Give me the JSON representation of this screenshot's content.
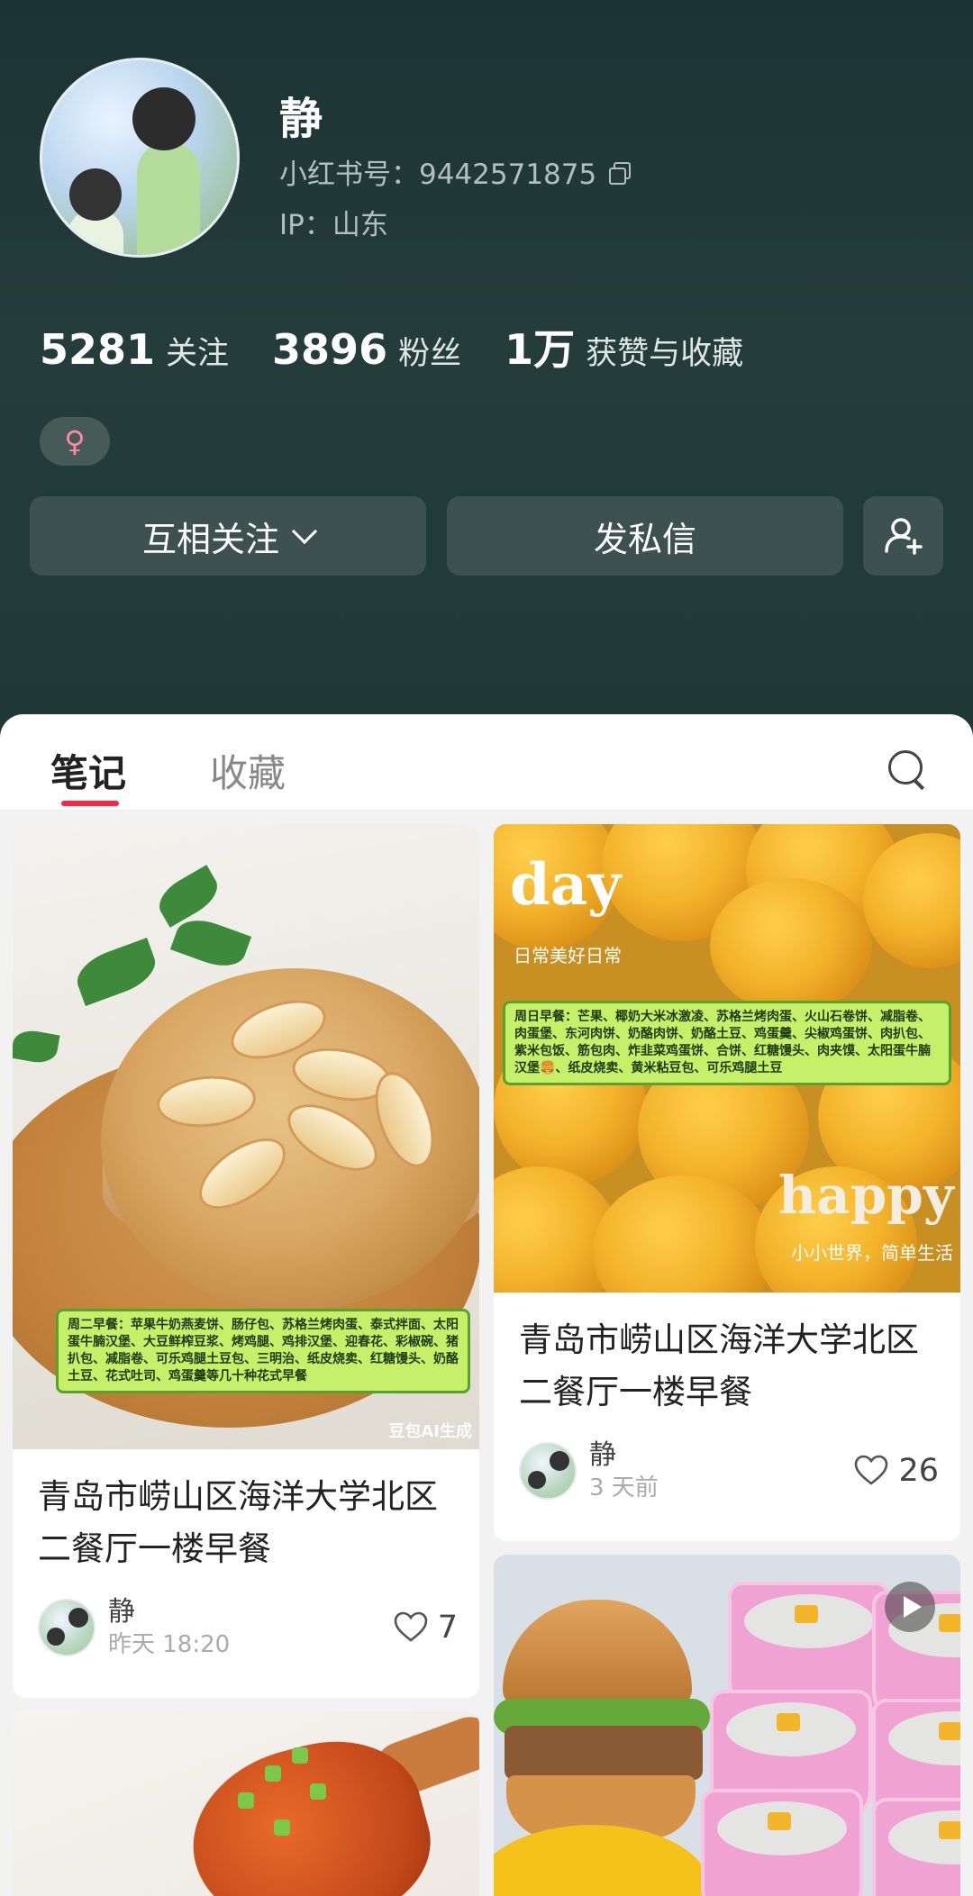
{
  "profile": {
    "name": "静",
    "red_id": "小红书号：9442571875",
    "ip": "IP：山东",
    "gender_symbol": "♀"
  },
  "stats": [
    {
      "num": "5281",
      "label": "关注"
    },
    {
      "num": "3896",
      "label": "粉丝"
    },
    {
      "num": "1万",
      "label": "获赞与收藏"
    }
  ],
  "actions": {
    "follow_label": "互相关注",
    "message_label": "发私信"
  },
  "tabs": {
    "notes": "笔记",
    "collect": "收藏"
  },
  "cards": [
    {
      "title": "青岛市崂山区海洋大学北区二餐厅一楼早餐",
      "author": "静",
      "time": "昨天 18:20",
      "likes": "7",
      "image_caption": "周二早餐：苹果牛奶燕麦饼、肠仔包、苏格兰烤肉蛋、泰式拌面、太阳蛋牛腩汉堡、大豆鲜榨豆浆、烤鸡腿、鸡排汉堡、迎春花、彩椒碗、猪扒包、减脂卷、可乐鸡腿土豆包、三明治、纸皮烧卖、红糖馒头、奶酪土豆、花式吐司、鸡蛋羹等几十种花式早餐",
      "image_watermark": "豆包AI生成"
    },
    {
      "title": "青岛市崂山区海洋大学北区二餐厅一楼早餐",
      "author": "静",
      "time": "3 天前",
      "likes": "26",
      "image_caption": "周日早餐：芒果、椰奶大米冰激凌、苏格兰烤肉蛋、火山石卷饼、减脂卷、肉蛋堡、东河肉饼、奶酪肉饼、奶酪土豆、鸡蛋羹、尖椒鸡蛋饼、肉扒包、紫米包饭、筋包肉、炸韭菜鸡蛋饼、合饼、红糖馒头、肉夹馍、太阳蛋牛腩汉堡🍔、纸皮烧卖、黄米粘豆包、可乐鸡腿土豆",
      "image_word_1": "day",
      "image_sub_1": "日常美好日常",
      "image_word_2": "happy",
      "image_sub_2": "小小世界，简单生活"
    }
  ],
  "icons": {
    "copy": "copy-icon",
    "add_user": "add-user-icon",
    "search": "search-icon",
    "heart": "heart-icon",
    "play": "play-icon"
  },
  "colors": {
    "accent": "#ff2442",
    "header_bg": "#1f3736"
  }
}
